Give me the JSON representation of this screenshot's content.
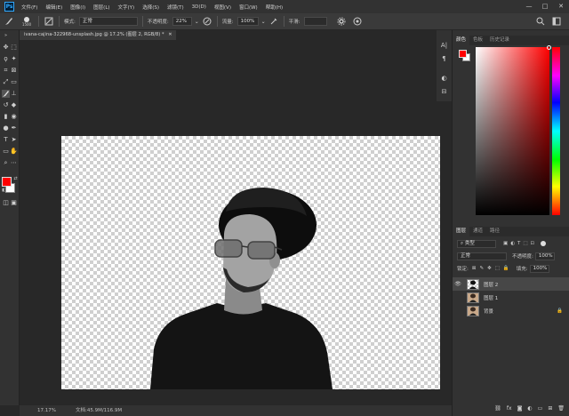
{
  "app": {
    "logo": "Ps"
  },
  "menu": [
    "文件(F)",
    "编辑(E)",
    "图像(I)",
    "图层(L)",
    "文字(Y)",
    "选择(S)",
    "滤镜(T)",
    "3D(D)",
    "视图(V)",
    "窗口(W)",
    "帮助(H)"
  ],
  "window_controls": {
    "minimize": "—",
    "maximize": "□",
    "close": "✕"
  },
  "options": {
    "brush_size": "1500",
    "mode_label": "模式:",
    "mode_value": "正常",
    "opacity_label": "不透明度:",
    "opacity_value": "22%",
    "flow_label": "流量:",
    "flow_value": "100%",
    "smoothing_label": "平滑:"
  },
  "document": {
    "tab_title": "ivana-cajina-322968-unsplash.jpg @ 17.2% (图层 2, RGB/8) *"
  },
  "status": {
    "zoom": "17.17%",
    "doc_size": "文档:45.9M/116.9M"
  },
  "colors": {
    "foreground": "#ff0000",
    "background": "#ffffff",
    "accent": "#31a8ff"
  },
  "panels": {
    "color_tabs": [
      "颜色",
      "色板",
      "历史记录"
    ],
    "layers_tabs": [
      "图层",
      "通道",
      "路径"
    ],
    "kind_filter": "类型",
    "blend_mode": "正常",
    "opacity_label": "不透明度:",
    "opacity_value": "100%",
    "lock_label": "锁定:",
    "fill_label": "填充:",
    "fill_value": "100%"
  },
  "layers": [
    {
      "name": "图层 2",
      "selected": true,
      "visible": true,
      "thumb": "check",
      "locked": false
    },
    {
      "name": "图层 1",
      "selected": false,
      "visible": false,
      "thumb": "person",
      "locked": false
    },
    {
      "name": "背景",
      "selected": false,
      "visible": false,
      "thumb": "person",
      "locked": true
    }
  ]
}
